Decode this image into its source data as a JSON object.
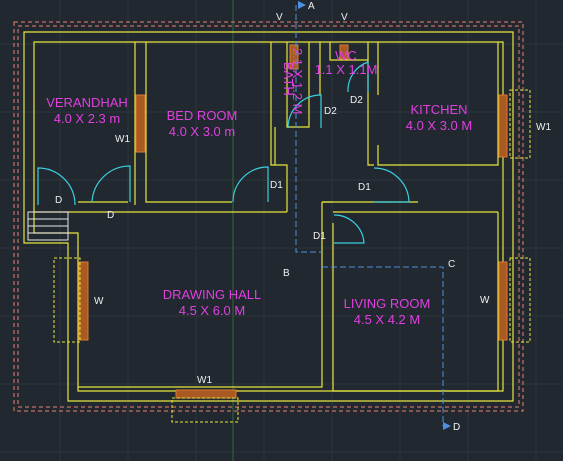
{
  "rooms": {
    "verandah": {
      "name": "VERANDHAH",
      "size": "4.0 X 2.3 m"
    },
    "bedroom": {
      "name": "BED ROOM",
      "size": "4.0 X 3.0 m"
    },
    "bath": {
      "name": "BATH",
      "size": "2.1 X 1.2 M"
    },
    "wc": {
      "name": "WC",
      "size": "1.1 X 1.1M"
    },
    "kitchen": {
      "name": "KITCHEN",
      "size": "4.0 X 3.0 M"
    },
    "drawing_hall": {
      "name": "DRAWING HALL",
      "size": "4.5 X 6.0 M"
    },
    "living_room": {
      "name": "LIVING ROOM",
      "size": "4.5 X 4.2 M"
    }
  },
  "tags": {
    "w1_left": "W1",
    "w1_right": "W1",
    "w1_bottom": "W1",
    "w_left": "W",
    "w_right": "W",
    "d_verandah": "D",
    "d_hall": "D",
    "d1_bed": "D1",
    "d1_kitchen": "D1",
    "d1_living": "D1",
    "d2_bath": "D2",
    "d2_wc": "D2",
    "v_bath": "V",
    "v_wc": "V"
  },
  "section_markers": {
    "a": "A",
    "b": "B",
    "c": "C",
    "d": "D"
  },
  "colors": {
    "background": "#212830",
    "wall": "#e6e63c",
    "label": "#e040e0",
    "tag": "#f0f0f0",
    "door": "#39d0e0",
    "section_line": "#4f8fe0",
    "outer_dash": "#f08070",
    "window": "#e07a30"
  }
}
